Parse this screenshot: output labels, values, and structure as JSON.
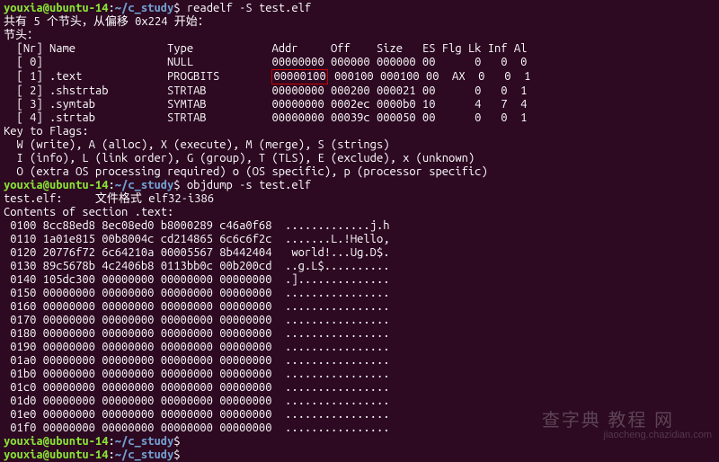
{
  "prompt": {
    "user_host": "youxia@ubuntu-14",
    "sep1": ":",
    "path": "~/c_study",
    "sep2": "$ "
  },
  "commands": {
    "readelf": "readelf -S test.elf",
    "objdump": "objdump -s test.elf",
    "empty": ""
  },
  "readelf": {
    "header1": "共有 5 个节头，从偏移 0x224 开始：",
    "blank": "",
    "sections_label": "节头：",
    "col_header": "  [Nr] Name              Type            Addr     Off    Size   ES Flg Lk Inf Al",
    "row0_a": "  [ 0]                   NULL            00000000 000000 000000 00      0   0  0",
    "row1_a": "  [ 1] .text             PROGBITS        ",
    "row1_addr": "00000100",
    "row1_b": " 000100 000100 00  AX  0   0  1",
    "row2": "  [ 2] .shstrtab         STRTAB          00000000 000200 000021 00      0   0  1",
    "row3": "  [ 3] .symtab           SYMTAB          00000000 0002ec 0000b0 10      4   7  4",
    "row4": "  [ 4] .strtab           STRTAB          00000000 00039c 000050 00      0   0  1",
    "key_title": "Key to Flags:",
    "key1": "  W (write), A (alloc), X (execute), M (merge), S (strings)",
    "key2": "  I (info), L (link order), G (group), T (TLS), E (exclude), x (unknown)",
    "key3": "  O (extra OS processing required) o (OS specific), p (processor specific)"
  },
  "objdump": {
    "file_line": "test.elf:     文件格式 elf32-i386",
    "blank": "",
    "contents_title": "Contents of section .text:",
    "rows": [
      " 0100 8cc88ed8 8ec08ed0 b8000289 c46a0f68  .............j.h",
      " 0110 1a01e815 00b8004c cd214865 6c6c6f2c  .......L.!Hello,",
      " 0120 20776f72 6c64210a 00005567 8b442404   world!...Ug.D$.",
      " 0130 89c5678b 4c2406b8 0113bb0c 00b200cd  ..g.L$..........",
      " 0140 105dc300 00000000 00000000 00000000  .]..............",
      " 0150 00000000 00000000 00000000 00000000  ................",
      " 0160 00000000 00000000 00000000 00000000  ................",
      " 0170 00000000 00000000 00000000 00000000  ................",
      " 0180 00000000 00000000 00000000 00000000  ................",
      " 0190 00000000 00000000 00000000 00000000  ................",
      " 01a0 00000000 00000000 00000000 00000000  ................",
      " 01b0 00000000 00000000 00000000 00000000  ................",
      " 01c0 00000000 00000000 00000000 00000000  ................",
      " 01d0 00000000 00000000 00000000 00000000  ................",
      " 01e0 00000000 00000000 00000000 00000000  ................",
      " 01f0 00000000 00000000 00000000 00000000  ................"
    ]
  },
  "watermarks": {
    "w1": "查字典  教程 网",
    "w2": "jiaocheng.chazidian.com"
  }
}
